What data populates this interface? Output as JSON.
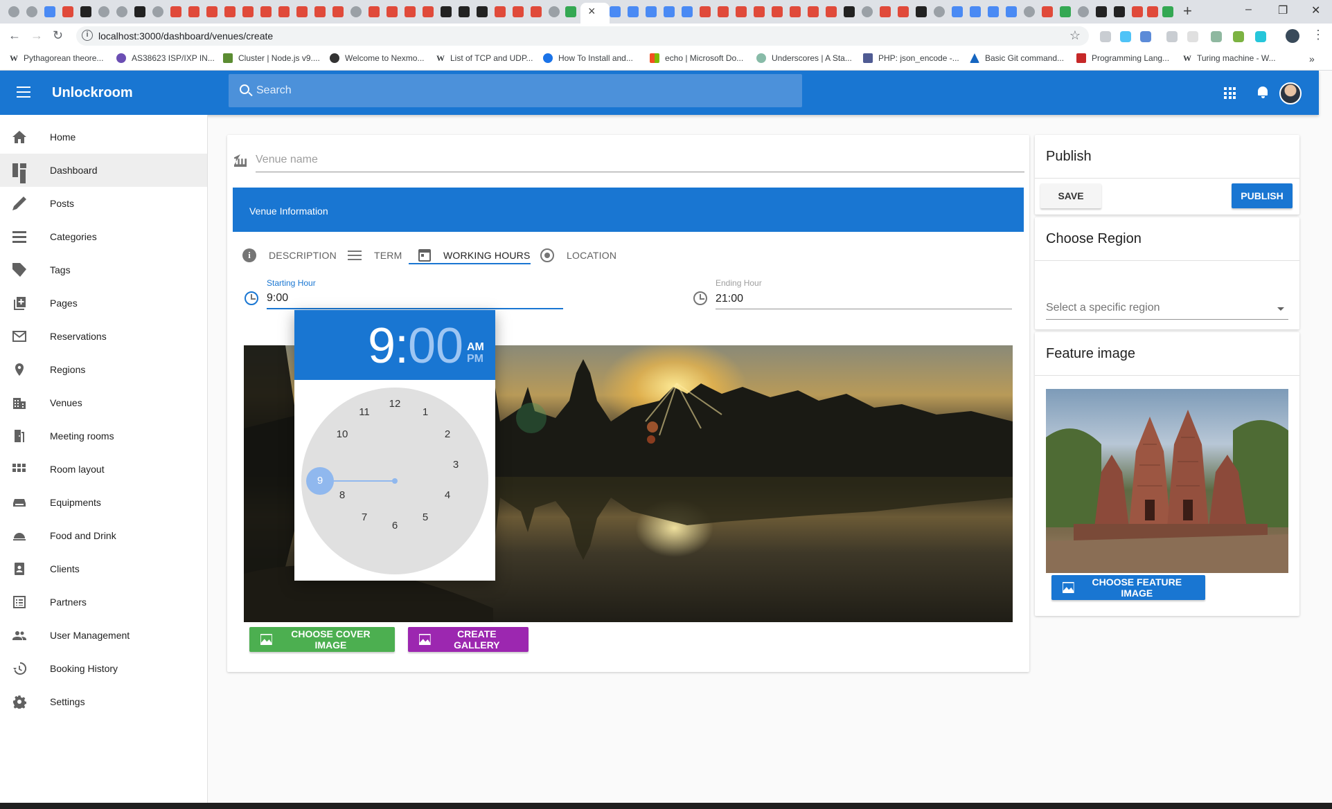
{
  "browser": {
    "url": "localhost:3000/dashboard/venues/create",
    "bookmarks": [
      "Pythagorean theore...",
      "AS38623 ISP/IXP IN...",
      "Cluster | Node.js v9....",
      "Welcome to Nexmo...",
      "List of TCP and UDP...",
      "How To Install and...",
      "echo | Microsoft Do...",
      "Underscores | A Sta...",
      "PHP: json_encode -...",
      "Basic Git command...",
      "Programming Lang...",
      "Turing machine - W..."
    ]
  },
  "app": {
    "brand": "Unlockroom",
    "search_placeholder": "Search"
  },
  "sidebar": {
    "items": [
      {
        "label": "Home",
        "icon": "home-icon"
      },
      {
        "label": "Dashboard",
        "icon": "dashboard-icon",
        "active": true
      },
      {
        "label": "Posts",
        "icon": "pencil-icon"
      },
      {
        "label": "Categories",
        "icon": "list-icon"
      },
      {
        "label": "Tags",
        "icon": "tag-icon"
      },
      {
        "label": "Pages",
        "icon": "pages-icon"
      },
      {
        "label": "Reservations",
        "icon": "mail-icon"
      },
      {
        "label": "Regions",
        "icon": "pin-icon"
      },
      {
        "label": "Venues",
        "icon": "venue-icon"
      },
      {
        "label": "Meeting rooms",
        "icon": "meeting-room-icon"
      },
      {
        "label": "Room layout",
        "icon": "room-layout-icon"
      },
      {
        "label": "Equipments",
        "icon": "equipment-icon"
      },
      {
        "label": "Food and Drink",
        "icon": "food-icon"
      },
      {
        "label": "Clients",
        "icon": "clients-icon"
      },
      {
        "label": "Partners",
        "icon": "partners-icon"
      },
      {
        "label": "User Management",
        "icon": "users-icon"
      },
      {
        "label": "Booking History",
        "icon": "history-icon"
      },
      {
        "label": "Settings",
        "icon": "settings-icon"
      }
    ]
  },
  "form": {
    "venue_name_placeholder": "Venue name",
    "section_title": "Venue Information",
    "tabs": [
      {
        "label": "DESCRIPTION",
        "icon": "info-icon"
      },
      {
        "label": "TERM",
        "icon": "term-icon"
      },
      {
        "label": "WORKING HOURS",
        "icon": "calendar-icon",
        "active": true
      },
      {
        "label": "LOCATION",
        "icon": "location-icon"
      }
    ],
    "starting_hour_label": "Starting Hour",
    "starting_hour_value": "9:00",
    "ending_hour_label": "Ending Hour",
    "ending_hour_value": "21:00",
    "choose_cover_label": "CHOOSE COVER IMAGE",
    "create_gallery_label": "CREATE GALLERY"
  },
  "time_picker": {
    "hour": "9",
    "colon": ":",
    "minute": "00",
    "am": "AM",
    "pm": "PM",
    "dial": [
      "12",
      "1",
      "2",
      "3",
      "4",
      "5",
      "6",
      "7",
      "8",
      "9",
      "10",
      "11"
    ],
    "selected_hour": "9"
  },
  "publish_card": {
    "title": "Publish",
    "save_label": "SAVE",
    "publish_label": "PUBLISH"
  },
  "region_card": {
    "title": "Choose Region",
    "placeholder": "Select a specific region"
  },
  "feature_card": {
    "title": "Feature image",
    "button_label": "CHOOSE FEATURE IMAGE"
  },
  "colors": {
    "primary": "#1976d2",
    "green_button": "#4caf50",
    "purple_button": "#9c27b0"
  }
}
